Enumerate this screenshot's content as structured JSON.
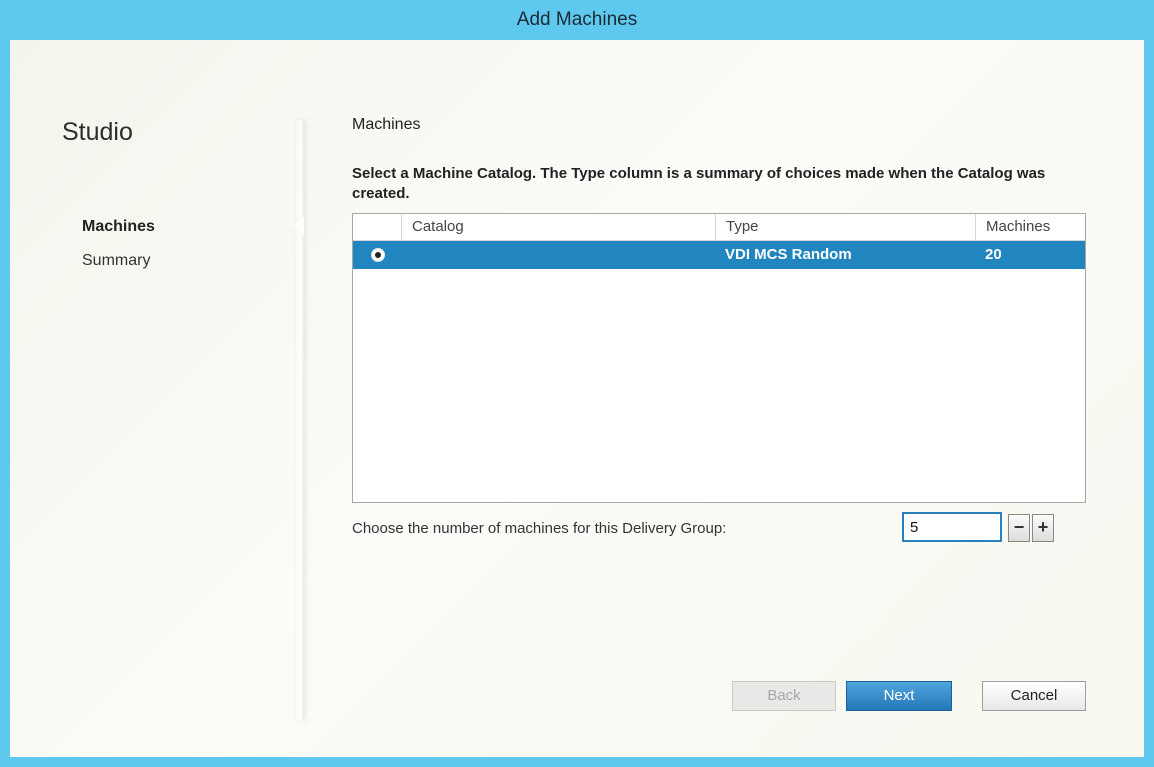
{
  "window": {
    "title": "Add Machines"
  },
  "sidebar": {
    "brand": "Studio",
    "items": [
      {
        "label": "Machines",
        "active": true
      },
      {
        "label": "Summary",
        "active": false
      }
    ]
  },
  "main": {
    "section_title": "Machines",
    "instruction": "Select a Machine Catalog. The Type column is a summary of choices made when the Catalog was created.",
    "table": {
      "columns": [
        "Catalog",
        "Type",
        "Machines"
      ],
      "rows": [
        {
          "catalog": "",
          "type": "VDI MCS Random",
          "machines": "20",
          "selected": true
        }
      ]
    },
    "machine_count": {
      "label": "Choose the number of machines for this Delivery Group:",
      "value": "5",
      "minus": "−",
      "plus": "+"
    }
  },
  "footer": {
    "back_label": "Back",
    "next_label": "Next",
    "cancel_label": "Cancel"
  },
  "colors": {
    "title_bar": "#5fc8ee",
    "selection": "#2186c0",
    "primary_button": "#2578b8"
  }
}
